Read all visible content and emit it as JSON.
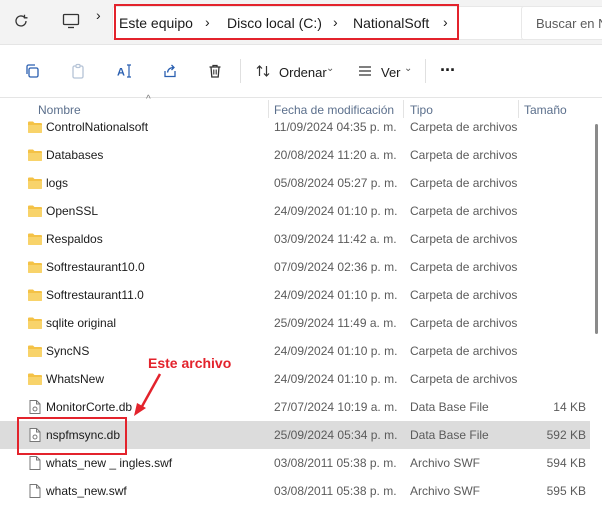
{
  "address_bar": {
    "breadcrumbs": [
      "Este equipo",
      "Disco local (C:)",
      "NationalSoft"
    ],
    "search_placeholder": "Buscar en N"
  },
  "toolbar": {
    "sort_label": "Ordenar",
    "view_label": "Ver",
    "more_label": "···"
  },
  "columns": {
    "name": "Nombre",
    "date": "Fecha de modificación",
    "type": "Tipo",
    "size": "Tamaño"
  },
  "files": [
    {
      "name": "ControlNationalsoft",
      "date": "11/09/2024 04:35 p. m.",
      "type": "Carpeta de archivos",
      "size": "",
      "kind": "folder"
    },
    {
      "name": "Databases",
      "date": "20/08/2024 11:20 a. m.",
      "type": "Carpeta de archivos",
      "size": "",
      "kind": "folder"
    },
    {
      "name": "logs",
      "date": "05/08/2024 05:27 p. m.",
      "type": "Carpeta de archivos",
      "size": "",
      "kind": "folder"
    },
    {
      "name": "OpenSSL",
      "date": "24/09/2024 01:10 p. m.",
      "type": "Carpeta de archivos",
      "size": "",
      "kind": "folder"
    },
    {
      "name": "Respaldos",
      "date": "03/09/2024 11:42 a. m.",
      "type": "Carpeta de archivos",
      "size": "",
      "kind": "folder"
    },
    {
      "name": "Softrestaurant10.0",
      "date": "07/09/2024 02:36 p. m.",
      "type": "Carpeta de archivos",
      "size": "",
      "kind": "folder"
    },
    {
      "name": "Softrestaurant11.0",
      "date": "24/09/2024 01:10 p. m.",
      "type": "Carpeta de archivos",
      "size": "",
      "kind": "folder"
    },
    {
      "name": "sqlite original",
      "date": "25/09/2024 11:49 a. m.",
      "type": "Carpeta de archivos",
      "size": "",
      "kind": "folder"
    },
    {
      "name": "SyncNS",
      "date": "24/09/2024 01:10 p. m.",
      "type": "Carpeta de archivos",
      "size": "",
      "kind": "folder"
    },
    {
      "name": "WhatsNew",
      "date": "24/09/2024 01:10 p. m.",
      "type": "Carpeta de archivos",
      "size": "",
      "kind": "folder"
    },
    {
      "name": "MonitorCorte.db",
      "date": "27/07/2024 10:19 a. m.",
      "type": "Data Base File",
      "size": "14 KB",
      "kind": "file"
    },
    {
      "name": "nspfmsync.db",
      "date": "25/09/2024 05:34 p. m.",
      "type": "Data Base File",
      "size": "592 KB",
      "kind": "file",
      "selected": true
    },
    {
      "name": "whats_new _ ingles.swf",
      "date": "03/08/2011 05:38 p. m.",
      "type": "Archivo SWF",
      "size": "594 KB",
      "kind": "doc"
    },
    {
      "name": "whats_new.swf",
      "date": "03/08/2011 05:38 p. m.",
      "type": "Archivo SWF",
      "size": "595 KB",
      "kind": "doc"
    }
  ],
  "annotation": {
    "text": "Este archivo",
    "color": "#e3232c"
  },
  "colors": {
    "folder": "#f4c246",
    "accent": "#0067c0",
    "highlight": "#e3232c",
    "selected_row": "#dcdcdc"
  }
}
